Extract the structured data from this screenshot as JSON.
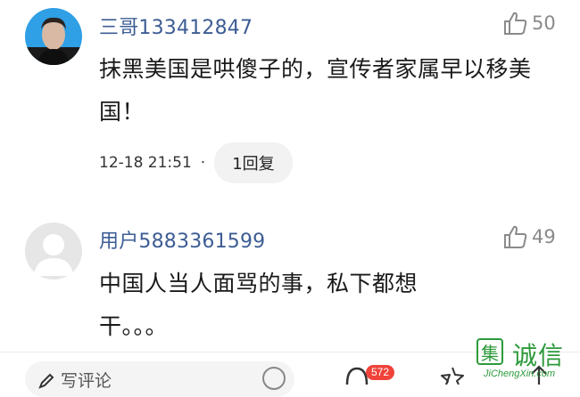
{
  "comments": [
    {
      "username": "三哥133412847",
      "likes": "50",
      "content": "抹黑美国是哄傻子的，宣传者家属早以移美国！",
      "time": "12-18 21:51",
      "dot": "·",
      "reply_label": "1回复",
      "avatar_icon": "user-photo-avatar"
    },
    {
      "username": "用户5883361599",
      "likes": "49",
      "content": "中国人当人面骂的事，私下都想干。。。",
      "avatar_icon": "default-gray-avatar"
    }
  ],
  "bottom_bar": {
    "input_placeholder": "写评论",
    "comment_count": "572",
    "icons": [
      "pencil-icon",
      "emoji-icon",
      "comment-icon",
      "star-icon",
      "share-icon"
    ]
  },
  "watermark": {
    "logo_char": "集",
    "brand": "诚信",
    "domain": "JiChengXin.com"
  },
  "colors": {
    "username": "#3d5d94",
    "badge": "#f0433a",
    "watermark": "#2c9a3b"
  }
}
